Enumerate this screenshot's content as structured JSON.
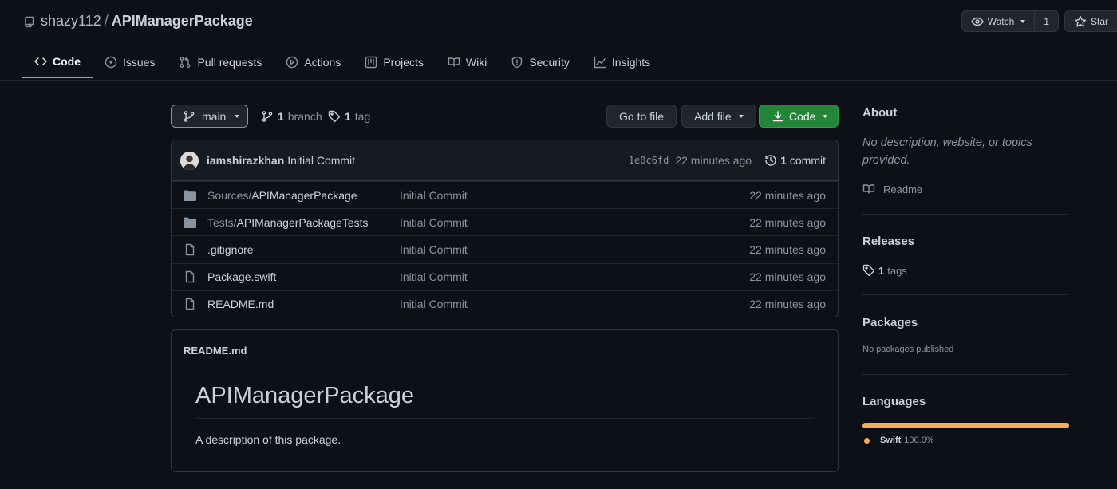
{
  "repo": {
    "owner": "shazy112",
    "separator": "/",
    "name": "APIManagerPackage"
  },
  "header_actions": {
    "watch_label": "Watch",
    "watch_count": "1",
    "star_label": "Star"
  },
  "tabs": [
    {
      "label": "Code",
      "icon": "code-icon",
      "active": true
    },
    {
      "label": "Issues",
      "icon": "issue-icon"
    },
    {
      "label": "Pull requests",
      "icon": "pull-request-icon"
    },
    {
      "label": "Actions",
      "icon": "play-icon"
    },
    {
      "label": "Projects",
      "icon": "project-icon"
    },
    {
      "label": "Wiki",
      "icon": "book-icon"
    },
    {
      "label": "Security",
      "icon": "shield-icon"
    },
    {
      "label": "Insights",
      "icon": "graph-icon"
    }
  ],
  "branch_bar": {
    "branch_name": "main",
    "branch_count": "1",
    "branch_label": "branch",
    "tag_count": "1",
    "tag_label": "tag",
    "go_to_file": "Go to file",
    "add_file": "Add file",
    "code": "Code"
  },
  "latest_commit": {
    "author": "iamshirazkhan",
    "message": "Initial Commit",
    "sha": "1e0c6fd",
    "time": "22 minutes ago",
    "count": "1",
    "count_label": "commit"
  },
  "files": [
    {
      "type": "folder",
      "prefix": "Sources/",
      "name": "APIManagerPackage",
      "message": "Initial Commit",
      "time": "22 minutes ago"
    },
    {
      "type": "folder",
      "prefix": "Tests/",
      "name": "APIManagerPackageTests",
      "message": "Initial Commit",
      "time": "22 minutes ago"
    },
    {
      "type": "file",
      "prefix": "",
      "name": ".gitignore",
      "message": "Initial Commit",
      "time": "22 minutes ago"
    },
    {
      "type": "file",
      "prefix": "",
      "name": "Package.swift",
      "message": "Initial Commit",
      "time": "22 minutes ago"
    },
    {
      "type": "file",
      "prefix": "",
      "name": "README.md",
      "message": "Initial Commit",
      "time": "22 minutes ago"
    }
  ],
  "readme": {
    "filename": "README.md",
    "title": "APIManagerPackage",
    "description": "A description of this package."
  },
  "sidebar": {
    "about_title": "About",
    "about_text": "No description, website, or topics provided.",
    "readme_link": "Readme",
    "releases_title": "Releases",
    "tags_count": "1",
    "tags_label": "tags",
    "packages_title": "Packages",
    "packages_text": "No packages published",
    "languages_title": "Languages",
    "languages": [
      {
        "name": "Swift",
        "percent": "100.0%",
        "share": 1.0,
        "color": "#f5ac5b"
      }
    ]
  },
  "colors": {
    "background": "#0d1117",
    "accent_green": "#238636",
    "active_tab_underline": "#f78166"
  }
}
